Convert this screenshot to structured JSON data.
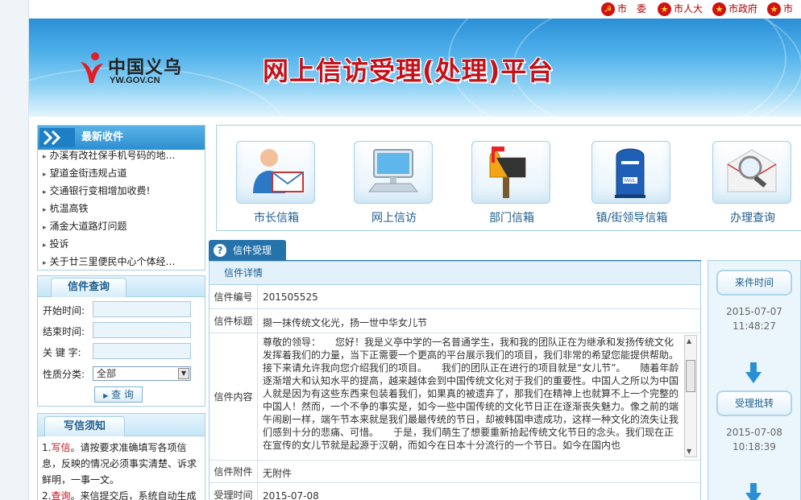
{
  "top_links": [
    {
      "label": "市　委",
      "icon": "party-emblem-icon"
    },
    {
      "label": "市人大",
      "icon": "national-emblem-icon"
    },
    {
      "label": "市政府",
      "icon": "national-emblem-icon"
    },
    {
      "label": "市政",
      "icon": "national-emblem-icon"
    }
  ],
  "banner": {
    "logo_cn": "中国义乌",
    "logo_en": "YW.GOV.CN",
    "title": "网上信访受理(处理)平台"
  },
  "news": {
    "title": "最新收件",
    "items": [
      "办溪有改社保手机号码的地…",
      "望道金街违规占道",
      "交通银行变相增加收费!",
      "杭温高铁",
      "涌金大道路灯问题",
      "投诉",
      "关于廿三里便民中心个体经…"
    ]
  },
  "query": {
    "title": "信件查询",
    "start_label": "开始时间:",
    "end_label": "结束时间:",
    "keyword_label": "关 键 字:",
    "type_label": "性质分类:",
    "type_value": "全部",
    "button": "查 询"
  },
  "guide": {
    "title": "写信须知",
    "lines": [
      {
        "prefix": "1.",
        "hl": "写信",
        "text": "。请按要求准确填写各项信"
      },
      {
        "prefix": "",
        "hl": "",
        "text": "息，反映的情况必须事实清楚、诉求"
      },
      {
        "prefix": "",
        "hl": "",
        "text": "鲜明，一事一文。"
      },
      {
        "prefix": "2.",
        "hl": "查询",
        "text": "。来信提交后，系统自动生成"
      }
    ]
  },
  "nav": [
    {
      "label": "市长信箱",
      "icon": "mayor-mail-icon"
    },
    {
      "label": "网上信访",
      "icon": "computer-icon"
    },
    {
      "label": "部门信箱",
      "icon": "mailbox-icon"
    },
    {
      "label": "镇/街领导信箱",
      "icon": "blue-mailbox-icon"
    },
    {
      "label": "办理查询",
      "icon": "magnifier-icon"
    }
  ],
  "content_tab": "信件受理",
  "detail": {
    "header": "信件详情",
    "number_label": "信件编号",
    "number": "201505525",
    "title_label": "信件标题",
    "title": "撷一抹传统文化光，扬一世中华女儿节",
    "content_label": "信件内容",
    "content": "尊敬的领导：　　您好！我是义亭中学的一名普通学生，我和我的团队正在为继承和发扬传统文化发挥着我们的力量，当下正需要一个更高的平台展示我们的项目，我们非常的希望您能提供帮助。接下来请允许我向您介绍我们的项目。　　我们的团队正在进行的项目就是“女儿节”。　　随着年龄逐渐增大和认知水平的提高，越来越体会到中国传统文化对于我们的重要性。中国人之所以为中国人就是因为有这些东西来包装着我们，如果真的被遗弃了，那我们在精神上也就算不上一个完整的中国人！然而，一个不争的事实是，如今一些中国传统的文化节日正在逐渐丧失魅力。像之前的端午闹剧一样，端午节本来就是我们最最传统的节日，却被韩国申遗成功，这样一种文化的流失让我们感到十分的悲痛、可惜。　　于是，我们萌生了想要重新拾起传统文化节日的念头。我们现在正在宣传的女儿节就是起源于汉朝，而如今在日本十分流行的一个节日。如今在国内也",
    "attach_label": "信件附件",
    "attach": "无附件",
    "time_label": "受理时间",
    "time": "2015-07-08"
  },
  "progress": [
    {
      "label": "来件时间",
      "date": "2015-07-07",
      "time": "11:48:27"
    },
    {
      "label": "受理批转",
      "date": "2015-07-08",
      "time": "10:18:39"
    }
  ]
}
